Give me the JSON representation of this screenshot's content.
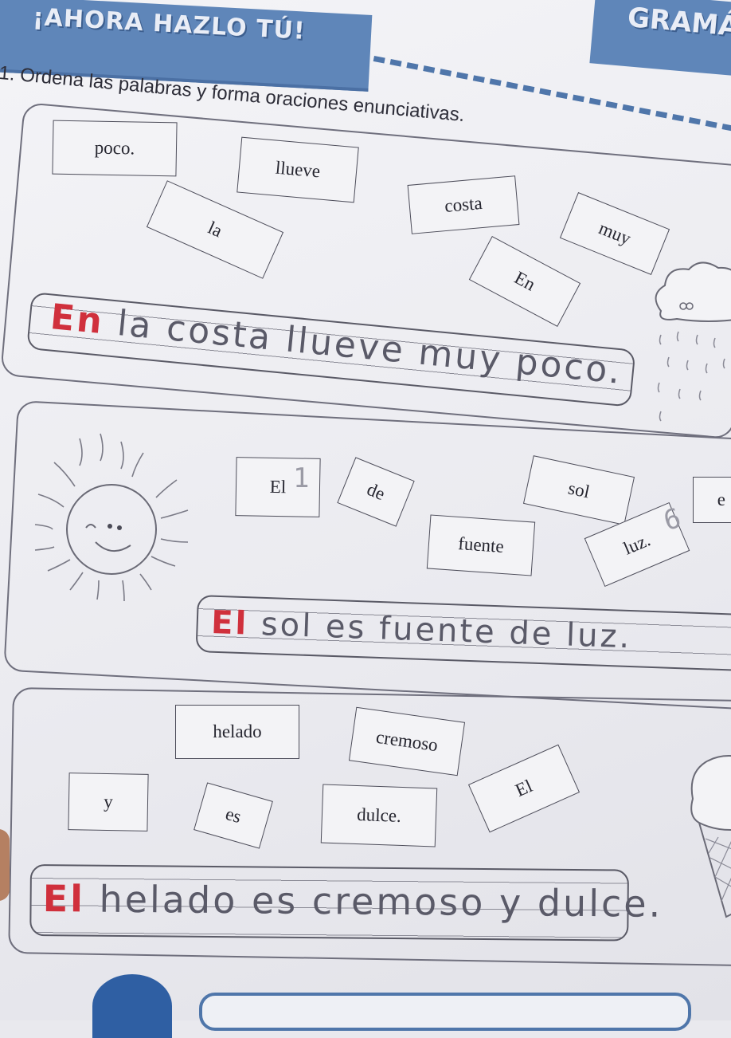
{
  "header": {
    "banner_title": "¡AHORA HAZLO TÚ!",
    "section_title": "GRAMÁ"
  },
  "instruction": {
    "number": "1.",
    "text": "Ordena las palabras y forma oraciones enunciativas."
  },
  "exercises": [
    {
      "cards": [
        "poco.",
        "llueve",
        "costa",
        "la",
        "muy",
        "En"
      ],
      "answer": {
        "first": "En",
        "rest": " la costa llueve muy poco."
      }
    },
    {
      "cards": [
        "El",
        "de",
        "sol",
        "fuente",
        "luz.",
        "e"
      ],
      "marks": [
        "1",
        "6"
      ],
      "answer": {
        "first": "El",
        "rest": " sol es fuente de luz."
      }
    },
    {
      "cards": [
        "helado",
        "cremoso",
        "El",
        "y",
        "es",
        "dulce."
      ],
      "answer": {
        "first": "El",
        "rest": " helado es cremoso y dulce."
      }
    }
  ],
  "colors": {
    "banner": "#5f86b9",
    "handwriting_red": "#d0303c",
    "handwriting_pencil": "#5a5a68"
  },
  "illustrations": [
    "rain-cloud-icon",
    "sun-icon",
    "ice-cream-icon"
  ]
}
